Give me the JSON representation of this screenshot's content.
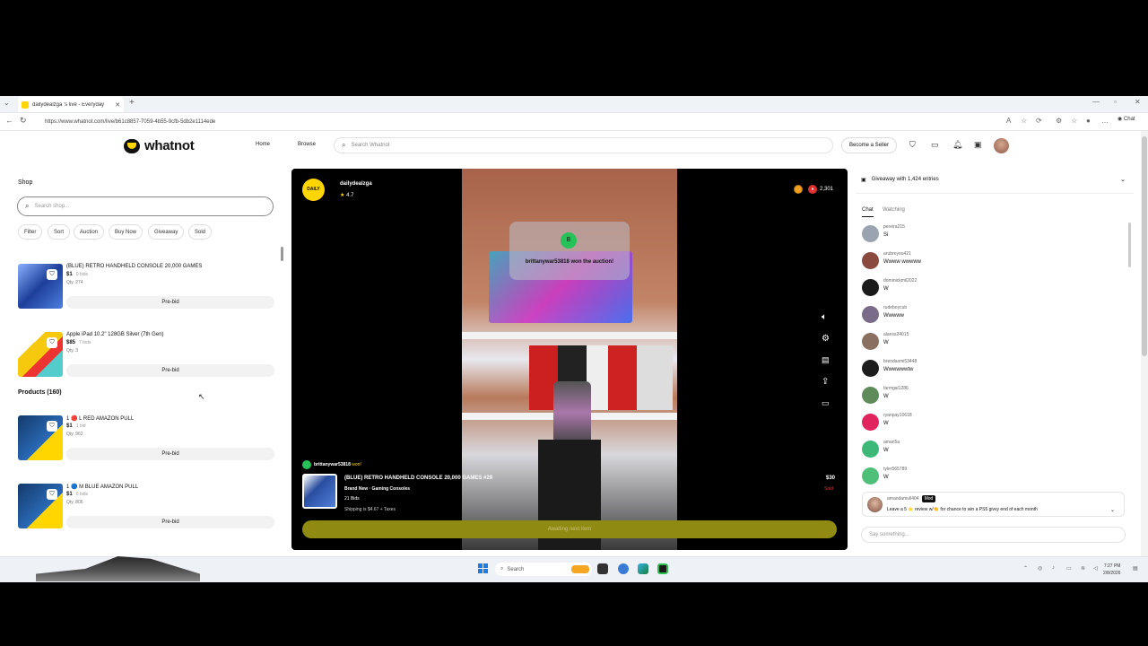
{
  "browser": {
    "tab_title": "dailydealzga 's live - Everyday",
    "url": "https://www.whatnot.com/live/b61c8857-7059-4b55-9cfb-5db2e1114ede",
    "chat_label": "Chat"
  },
  "header": {
    "brand": "whatnot",
    "nav": [
      "Home",
      "Browse"
    ],
    "search_placeholder": "Search Whatnot",
    "become_seller": "Become a Seller"
  },
  "shop": {
    "title": "Shop",
    "search_placeholder": "Search shop...",
    "filters": [
      "Filter",
      "Sort",
      "Auction",
      "Buy Now",
      "Giveaway",
      "Sold"
    ],
    "items": [
      {
        "name": "(BLUE) RETRO HANDHELD CONSOLE 20,000 GAMES",
        "price": "$1",
        "bids": "0 bids",
        "qty": "Qty. 274",
        "action": "Pre-bid"
      },
      {
        "name": "Apple iPad 10.2\" 128GB Silver (7th Gen)",
        "price": "$85",
        "bids": "7 bids",
        "qty": "Qty. 3",
        "action": "Pre-bid"
      }
    ],
    "products_heading": "Products (160)",
    "products": [
      {
        "name": "1 🔴 L RED AMAZON PULL",
        "price": "$1",
        "bids": "1 bid",
        "qty": "Qty. 962",
        "action": "Pre-bid"
      },
      {
        "name": "1 🔵 M BLUE AMAZON PULL",
        "price": "$1",
        "bids": "0 bids",
        "qty": "Qty. 806",
        "action": "Pre-bid"
      }
    ]
  },
  "stream": {
    "host": "dailydealzga",
    "host_logo": "DAILY",
    "rating": "4.7",
    "viewers": "2,301",
    "win_badge": "B",
    "win_message": "brittanywar53818 won the auction!",
    "winner_user": "brittanywar53818",
    "winner_suffix": "won!",
    "lot": {
      "title": "(BLUE) RETRO HANDHELD CONSOLE 20,000 GAMES #29",
      "subtitle": "Brand New · Gaming Consoles",
      "bids": "21 Bids",
      "shipping": "Shipping is $4.67 + Taxes",
      "price": "$30",
      "status": "Sold"
    },
    "await_label": "Awaiting next item"
  },
  "chat": {
    "giveaway": "Giveaway with 1,424 entries",
    "tabs": [
      "Chat",
      "Watching"
    ],
    "messages": [
      {
        "user": "pereira215",
        "text": "Si",
        "color": "#9aa4b0"
      },
      {
        "user": "arubreyou421",
        "text": "Wwww wwwww",
        "color": "#8a4a40"
      },
      {
        "user": "dominickmil2022",
        "text": "W",
        "color": "#1a1a1a"
      },
      {
        "user": "rudeboycub",
        "text": "Wwwww",
        "color": "#7a6c88"
      },
      {
        "user": "alanss24015",
        "text": "W",
        "color": "#8a7060"
      },
      {
        "user": "brendasmi53448",
        "text": "Wwwwwwtw",
        "color": "#1c1c1c"
      },
      {
        "user": "farmgal1286",
        "text": "W",
        "color": "#5f8a5a"
      },
      {
        "user": "ryanpay10618",
        "text": "W",
        "color": "#e0245e"
      },
      {
        "user": "aman5a",
        "text": "W",
        "color": "#3cb878"
      },
      {
        "user": "tyler565789",
        "text": "W",
        "color": "#4fc07a"
      }
    ],
    "pinned": {
      "user": "amandamull404",
      "badge": "Mod",
      "text": "Leave a 5 ⭐ review w/👏 for chance to win a PS5 givvy end of each month"
    },
    "input_placeholder": "Say something..."
  },
  "taskbar": {
    "search": "Search",
    "time": "7:27 PM",
    "date": "2/8/2026"
  }
}
